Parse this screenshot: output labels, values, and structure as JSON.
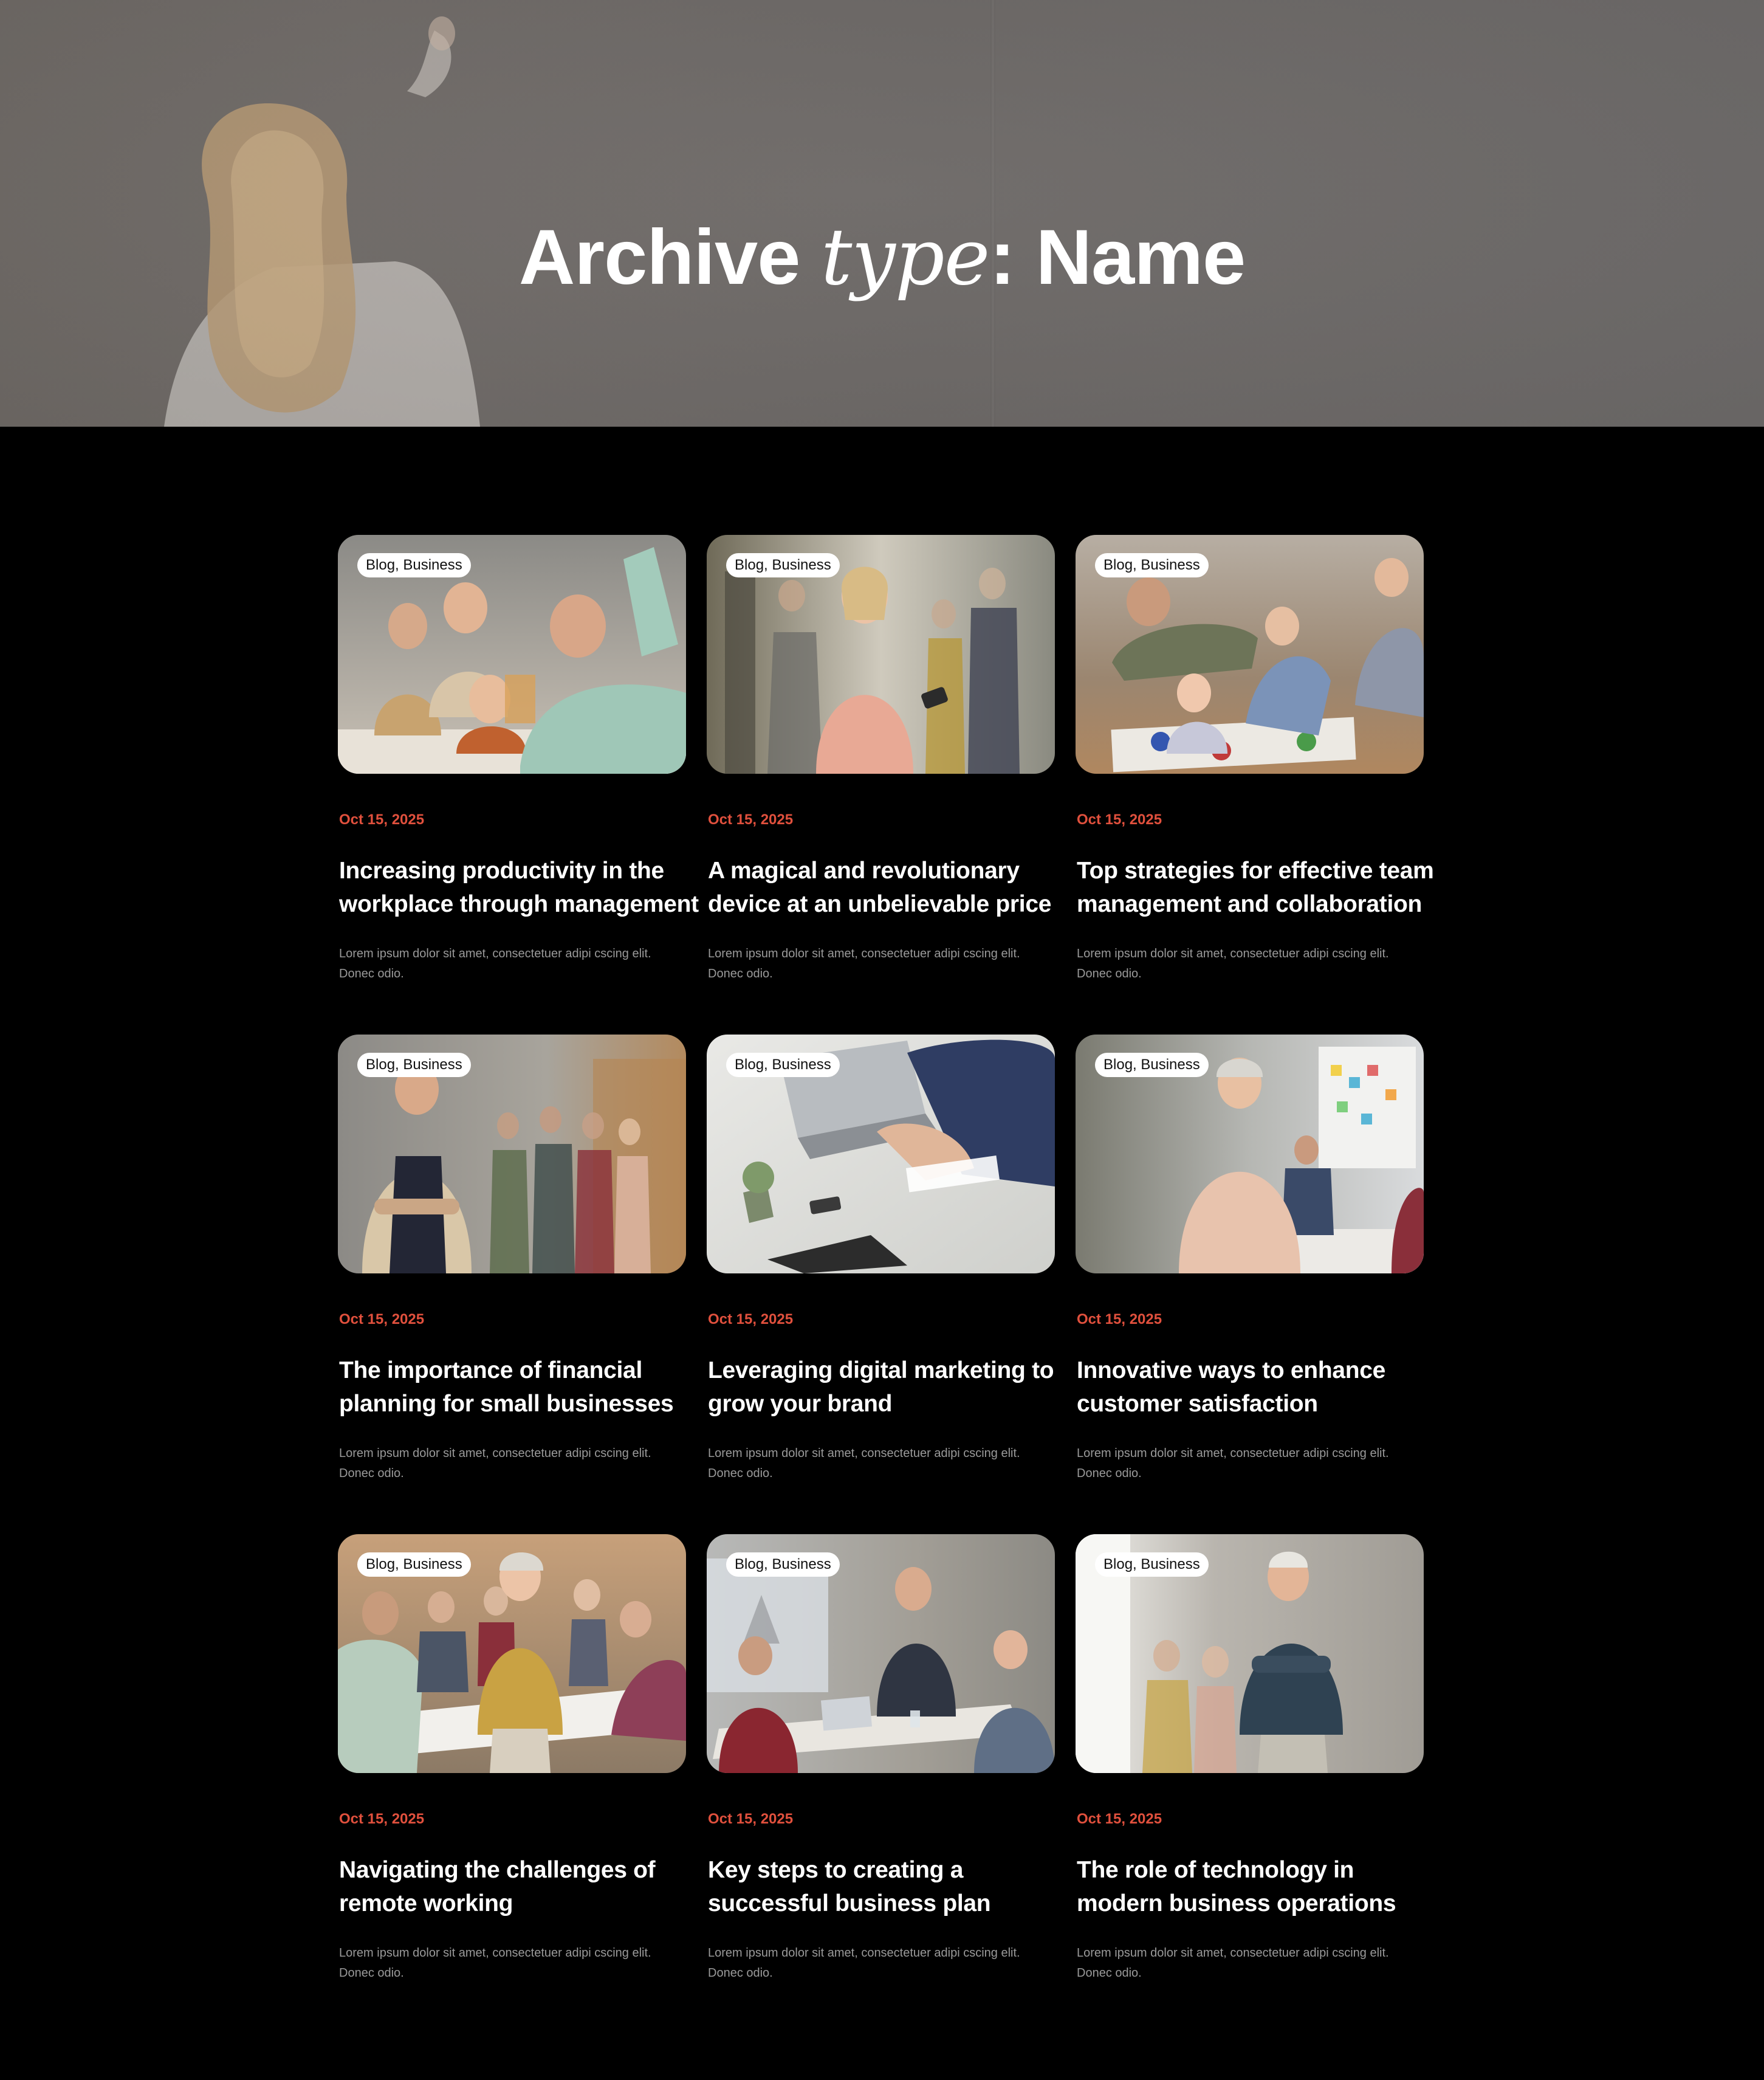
{
  "hero": {
    "title_part1": "Archive ",
    "title_italic": "type",
    "title_part2": ": Name"
  },
  "colors": {
    "page_background": "#000000",
    "date_accent": "#e0503d",
    "excerpt_gray": "#9a9a9a",
    "badge_background": "#ffffff"
  },
  "posts": [
    {
      "category": "Blog, Business",
      "date": "Oct 15, 2025",
      "title": "Increasing productivity in the workplace through management",
      "excerpt": "Lorem ipsum dolor sit amet, consectetuer adipi cscing elit. Donec odio."
    },
    {
      "category": "Blog, Business",
      "date": "Oct 15, 2025",
      "title": "A magical and revolutionary device at an unbelievable price",
      "excerpt": "Lorem ipsum dolor sit amet, consectetuer adipi cscing elit. Donec odio."
    },
    {
      "category": "Blog, Business",
      "date": "Oct 15, 2025",
      "title": "Top strategies for effective team management and collaboration",
      "excerpt": "Lorem ipsum dolor sit amet, consectetuer adipi cscing elit. Donec odio."
    },
    {
      "category": "Blog, Business",
      "date": "Oct 15, 2025",
      "title": "The importance of financial planning for small businesses",
      "excerpt": "Lorem ipsum dolor sit amet, consectetuer adipi cscing elit. Donec odio."
    },
    {
      "category": "Blog, Business",
      "date": "Oct 15, 2025",
      "title": "Leveraging digital marketing to grow your brand",
      "excerpt": "Lorem ipsum dolor sit amet, consectetuer adipi cscing elit. Donec odio."
    },
    {
      "category": "Blog, Business",
      "date": "Oct 15, 2025",
      "title": "Innovative ways to enhance customer satisfaction",
      "excerpt": "Lorem ipsum dolor sit amet, consectetuer adipi cscing elit. Donec odio."
    },
    {
      "category": "Blog, Business",
      "date": "Oct 15, 2025",
      "title": "Navigating the challenges of remote working",
      "excerpt": "Lorem ipsum dolor sit amet, consectetuer adipi cscing elit. Donec odio."
    },
    {
      "category": "Blog, Business",
      "date": "Oct 15, 2025",
      "title": "Key steps to creating a successful business plan",
      "excerpt": "Lorem ipsum dolor sit amet, consectetuer adipi cscing elit. Donec odio."
    },
    {
      "category": "Blog, Business",
      "date": "Oct 15, 2025",
      "title": "The role of technology in modern business operations",
      "excerpt": "Lorem ipsum dolor sit amet, consectetuer adipi cscing elit. Donec odio."
    }
  ]
}
